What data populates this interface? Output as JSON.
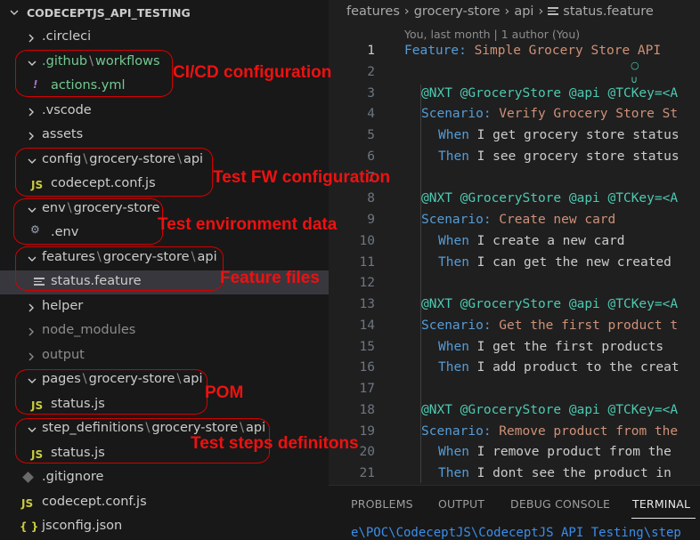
{
  "explorer": {
    "title": "CODECEPTJS_API_TESTING",
    "items": [
      {
        "parts": [
          ".circleci"
        ]
      },
      {
        "parts": [
          ".github",
          "workflows"
        ]
      },
      {
        "parts": [
          "actions.yml"
        ]
      },
      {
        "parts": [
          ".vscode"
        ]
      },
      {
        "parts": [
          "assets"
        ]
      },
      {
        "parts": [
          "config",
          "grocery-store",
          "api"
        ]
      },
      {
        "parts": [
          "codecept.conf.js"
        ]
      },
      {
        "parts": [
          "env",
          "grocery-store"
        ]
      },
      {
        "parts": [
          ".env"
        ]
      },
      {
        "parts": [
          "features",
          "grocery-store",
          "api"
        ]
      },
      {
        "parts": [
          "status.feature"
        ]
      },
      {
        "parts": [
          "helper"
        ]
      },
      {
        "parts": [
          "node_modules"
        ]
      },
      {
        "parts": [
          "output"
        ]
      },
      {
        "parts": [
          "pages",
          "grocery-store",
          "api"
        ]
      },
      {
        "parts": [
          "status.js"
        ]
      },
      {
        "parts": [
          "step_definitions",
          "grocery-store",
          "api"
        ]
      },
      {
        "parts": [
          "status.js"
        ]
      },
      {
        "parts": [
          ".gitignore"
        ]
      },
      {
        "parts": [
          "codecept.conf.js"
        ]
      },
      {
        "parts": [
          "jsconfig.json"
        ]
      }
    ],
    "icons": {
      "js": "JS",
      "yml": "!",
      "json": "{ }",
      "gear": "⚙"
    }
  },
  "annotations": [
    {
      "text": "CI/CD configuration"
    },
    {
      "text": "Test FW configuration"
    },
    {
      "text": "Test environment data"
    },
    {
      "text": "Feature files"
    },
    {
      "text": "POM"
    },
    {
      "text": "Test steps definitons"
    }
  ],
  "editor": {
    "breadcrumb": [
      "features",
      "grocery-store",
      "api",
      "status.feature"
    ],
    "blame": "You, last month | 1 author (You)",
    "lines": [
      {
        "n": "1",
        "kw": "Feature:",
        "rest": " Simple Grocery Store API"
      },
      {
        "n": "2"
      },
      {
        "n": "3",
        "tags": "@NXT @GroceryStore @api @TCKey=<A"
      },
      {
        "n": "4",
        "kw": "Scenario:",
        "rest": " Verify Grocery Store St"
      },
      {
        "n": "5",
        "kw": "When",
        "text": " I get grocery store status"
      },
      {
        "n": "6",
        "kw": "Then",
        "text": " I see grocery store status"
      },
      {
        "n": "7"
      },
      {
        "n": "8",
        "tags": "@NXT @GroceryStore @api @TCKey=<A"
      },
      {
        "n": "9",
        "kw": "Scenario:",
        "rest": " Create new card"
      },
      {
        "n": "10",
        "kw": "When",
        "text": " I create a new card"
      },
      {
        "n": "11",
        "kw": "Then",
        "text": " I can get the new created"
      },
      {
        "n": "12"
      },
      {
        "n": "13",
        "tags": "@NXT @GroceryStore @api @TCKey=<A"
      },
      {
        "n": "14",
        "kw": "Scenario:",
        "rest": " Get the first product t"
      },
      {
        "n": "15",
        "kw": "When",
        "text": " I get the first products"
      },
      {
        "n": "16",
        "kw": "Then",
        "text": " I add product to the creat"
      },
      {
        "n": "17"
      },
      {
        "n": "18",
        "tags": "@NXT @GroceryStore @api @TCKey=<A"
      },
      {
        "n": "19",
        "kw": "Scenario:",
        "rest": " Remove product from the"
      },
      {
        "n": "20",
        "kw": "When",
        "text": " I remove product from the"
      },
      {
        "n": "21",
        "kw": "Then",
        "text": " I dont see the product in"
      }
    ]
  },
  "panel": {
    "tabs": [
      "PROBLEMS",
      "OUTPUT",
      "DEBUG CONSOLE",
      "TERMINAL"
    ],
    "active_tab": "TERMINAL",
    "terminal_text": "e\\POC\\CodeceptJS\\CodeceptJS API Testing\\step"
  },
  "colors": {
    "annotation": "#ee1111",
    "keyword": "#569cd6",
    "string": "#ce9178",
    "tag": "#4ec9b0"
  }
}
